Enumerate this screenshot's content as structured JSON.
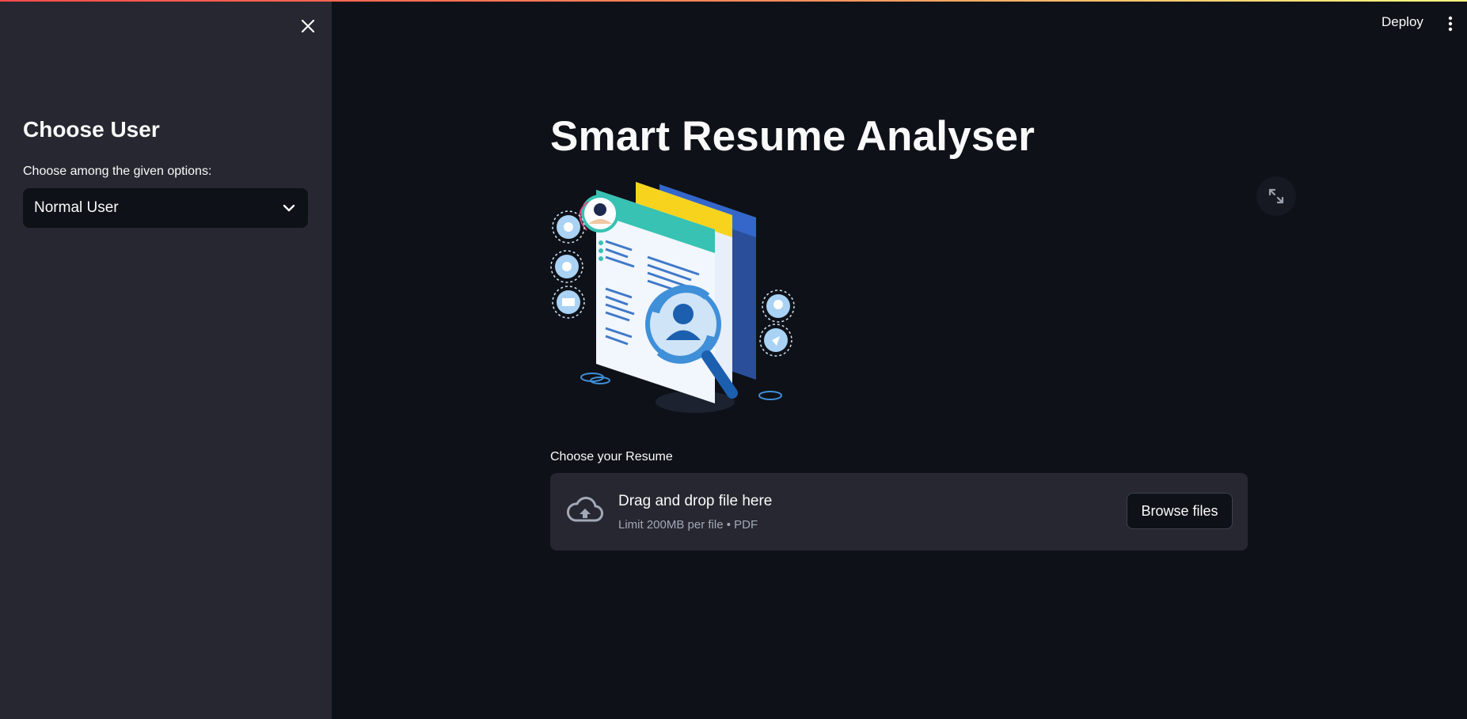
{
  "sidebar": {
    "title": "Choose User",
    "select_label": "Choose among the given options:",
    "select_value": "Normal User",
    "close_icon": "close-icon"
  },
  "header": {
    "deploy_label": "Deploy",
    "menu_icon": "vertical-dots-icon"
  },
  "main": {
    "title": "Smart Resume Analyser",
    "uploader": {
      "label": "Choose your Resume",
      "drop_title": "Drag and drop file here",
      "drop_subtitle": "Limit 200MB per file • PDF",
      "browse_label": "Browse files",
      "icon": "cloud-upload-icon"
    },
    "image_alt_icon": "resume-illustration"
  },
  "colors": {
    "background": "#0e1117",
    "sidebar": "#262730",
    "accent_gradient_start": "#ff4b4b",
    "accent_gradient_end": "#fffd80"
  }
}
